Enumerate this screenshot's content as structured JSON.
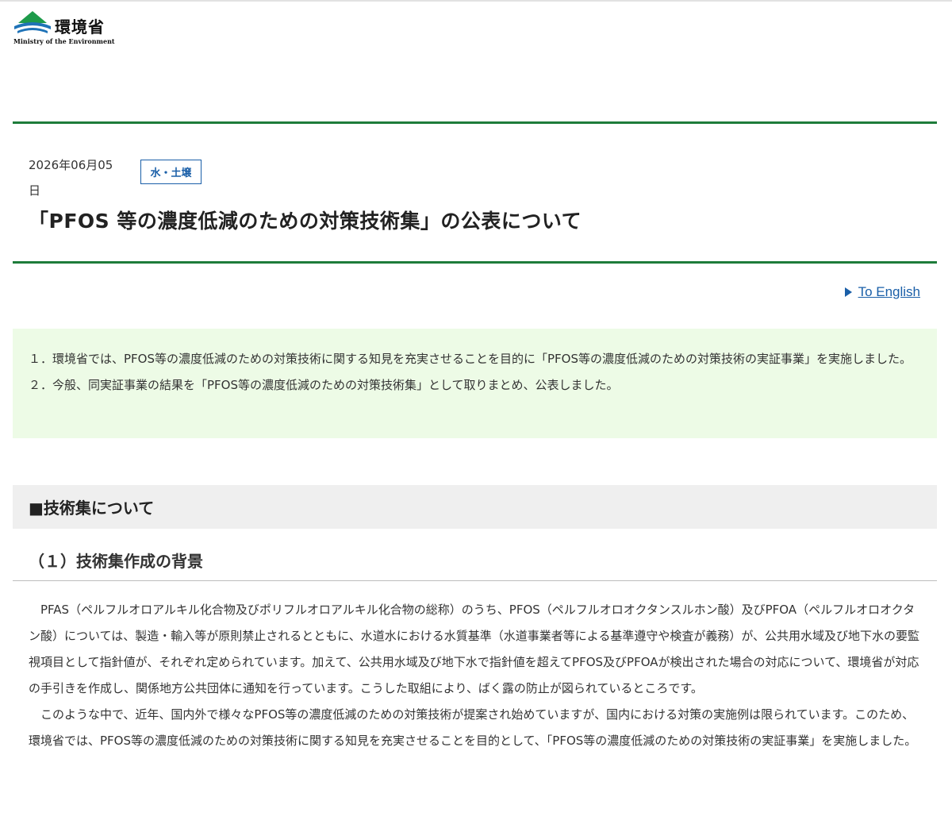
{
  "header": {
    "logo_jp": "環境省",
    "logo_en": "Ministry of the Environment",
    "logo_colors": {
      "green": "#1e9b4a",
      "blue": "#1f73b7"
    }
  },
  "article": {
    "date": "2026年06月05日",
    "tag": "水・土壌",
    "title": "「PFOS 等の濃度低減のための対策技術集」の公表について",
    "english_link": "To English",
    "summary": [
      "１．環境省では、PFOS等の濃度低減のための対策技術に関する知見を充実させることを目的に「PFOS等の濃度低減のための対策技術の実証事業」を実施しました。",
      "２．今般、同実証事業の結果を「PFOS等の濃度低減のための対策技術集」として取りまとめ、公表しました。"
    ]
  },
  "section": {
    "heading": "■技術集について",
    "subheading": "（１）技術集作成の背景",
    "paragraphs": [
      "PFAS（ペルフルオロアルキル化合物及びポリフルオロアルキル化合物の総称）のうち、PFOS（ペルフルオロオクタンスルホン酸）及びPFOA（ペルフルオロオクタン酸）については、製造・輸入等が原則禁止されるとともに、水道水における水質基準（水道事業者等による基準遵守や検査が義務）が、公共用水域及び地下水の要監視項目として指針値が、それぞれ定められています。加えて、公共用水域及び地下水で指針値を超えてPFOS及びPFOAが検出された場合の対応について、環境省が対応の手引きを作成し、関係地方公共団体に通知を行っています。こうした取組により、ばく露の防止が図られているところです。",
      "このような中で、近年、国内外で様々なPFOS等の濃度低減のための対策技術が提案され始めていますが、国内における対策の実施例は限られています。このため、環境省では、PFOS等の濃度低減のための対策技術に関する知見を充実させることを目的として、「PFOS等の濃度低減のための対策技術の実証事業」を実施しました。"
    ]
  },
  "colors": {
    "rule_green": "#1e7c3a",
    "link_blue": "#1a5fa8",
    "summary_bg": "#edfbe6",
    "heading_bg": "#efefef"
  }
}
